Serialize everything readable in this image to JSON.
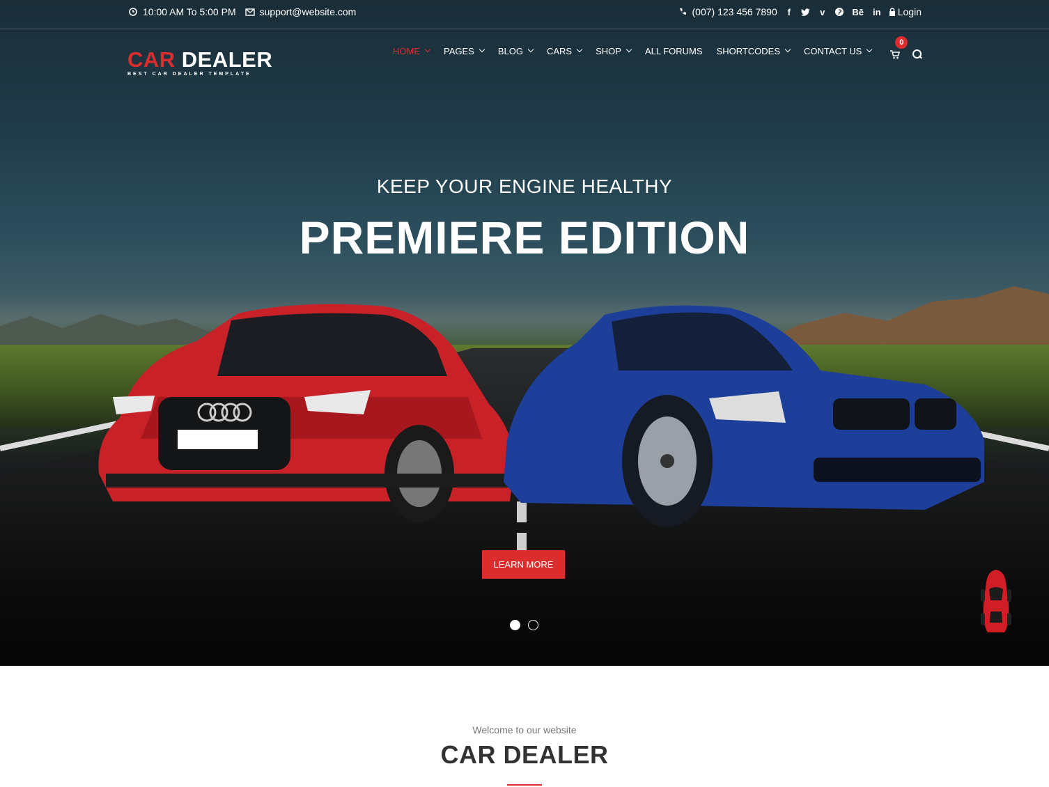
{
  "topbar": {
    "hours": "10:00 AM To 5:00 PM",
    "email": "support@website.com",
    "phone": "(007) 123 456 7890",
    "login_label": "Login",
    "social": [
      "f",
      "t",
      "v",
      "p",
      "Bē",
      "in"
    ]
  },
  "logo": {
    "main_red": "CAR",
    "main_white": "DEALER",
    "tagline": "BEST CAR DEALER TEMPLATE"
  },
  "nav": {
    "items": [
      {
        "label": "HOME"
      },
      {
        "label": "PAGES"
      },
      {
        "label": "BLOG"
      },
      {
        "label": "CARS"
      },
      {
        "label": "SHOP"
      },
      {
        "label": "ALL FORUMS"
      },
      {
        "label": "SHORTCODES"
      },
      {
        "label": "CONTACT US"
      }
    ],
    "cart_count": "0"
  },
  "hero": {
    "subtitle": "KEEP YOUR ENGINE HEALTHY",
    "headline": "PREMIERE EDITION",
    "button": "LEARN MORE"
  },
  "section": {
    "welcome": "Welcome to our website",
    "title": "CAR DEALER"
  },
  "colors": {
    "accent": "#db2d2e",
    "title_text": "#323232"
  }
}
